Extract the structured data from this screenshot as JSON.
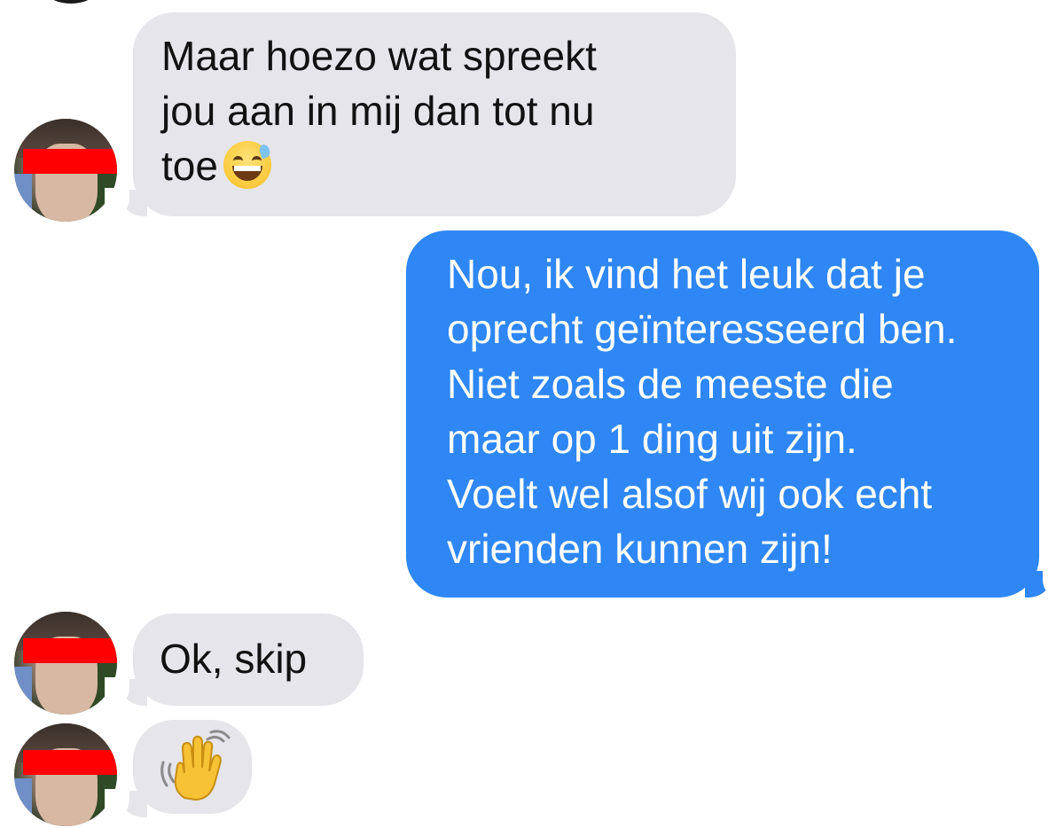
{
  "conversation": {
    "messages": [
      {
        "sender": "other",
        "lines": [
          "Maar hoezo wat spreekt",
          "jou aan in mij dan tot nu",
          "toe"
        ],
        "emoji": "grinning-face-with-sweat-icon"
      },
      {
        "sender": "me",
        "lines": [
          "Nou, ik vind het leuk dat je",
          "oprecht geïnteresseerd ben.",
          "Niet zoals de meeste die",
          "maar op 1 ding uit zijn.",
          "Voelt wel alsof wij ook echt",
          "vrienden kunnen zijn!"
        ]
      },
      {
        "sender": "other",
        "lines": [
          "Ok, skip"
        ]
      },
      {
        "sender": "other",
        "lines": [],
        "emoji": "waving-hand-icon"
      }
    ]
  },
  "colors": {
    "incoming_bubble": "#e5e5ea",
    "outgoing_bubble": "#2e87f4",
    "censor_bar": "#ff0000",
    "background": "#ffffff"
  }
}
